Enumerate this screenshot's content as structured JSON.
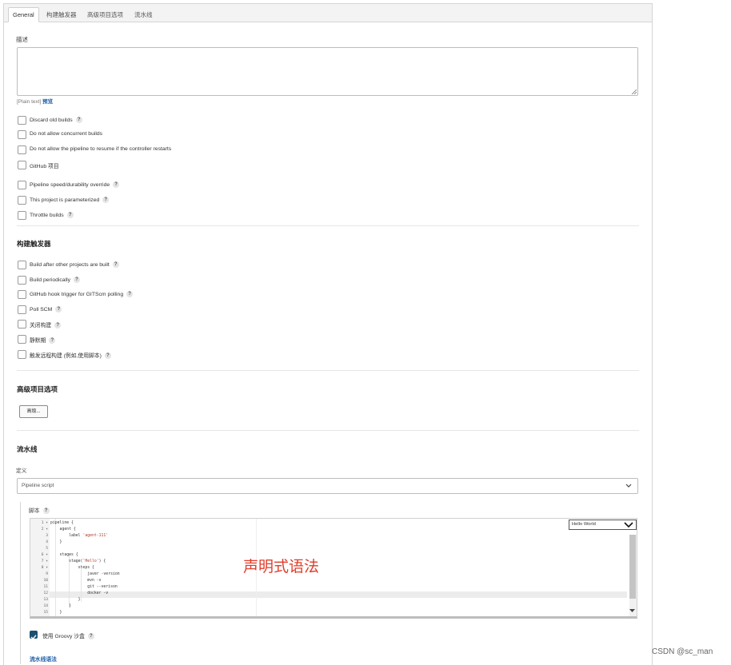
{
  "tabs": [
    {
      "label": "General"
    },
    {
      "label": "构建触发器"
    },
    {
      "label": "高级项目选项"
    },
    {
      "label": "流水线"
    }
  ],
  "general": {
    "description_label": "描述",
    "plain_text": "[Plain text]",
    "preview_link": "预览",
    "options": [
      {
        "label": "Discard old builds",
        "help": "?"
      },
      {
        "label": "Do not allow concurrent builds"
      },
      {
        "label": "Do not allow the pipeline to resume if the controller restarts"
      },
      {
        "label": "GitHub 项目"
      },
      {
        "label": "Pipeline speed/durability override",
        "help": "?"
      },
      {
        "label": "This project is parameterized",
        "help": "?"
      },
      {
        "label": "Throttle builds",
        "help": "?"
      }
    ]
  },
  "triggers": {
    "title": "构建触发器",
    "options": [
      {
        "label": "Build after other projects are built",
        "help": "?"
      },
      {
        "label": "Build periodically",
        "help": "?"
      },
      {
        "label": "GitHub hook trigger for GITScm polling",
        "help": "?"
      },
      {
        "label": "Poll SCM",
        "help": "?"
      },
      {
        "label": "关闭构建",
        "help": "?"
      },
      {
        "label": "静默期",
        "help": "?"
      },
      {
        "label": "触发远程构建 (例如,使用脚本)",
        "help": "?"
      }
    ]
  },
  "advanced": {
    "title": "高级项目选项",
    "button_label": "高级..."
  },
  "pipeline": {
    "title": "流水线",
    "definition_label": "定义",
    "definition_value": "Pipeline script",
    "script_label": "脚本",
    "script_help": "?",
    "sample_value": "Hello World",
    "code_lines": [
      {
        "no": "1 ▾",
        "text": "pipeline {"
      },
      {
        "no": "2 ▾",
        "text": "    agent {"
      },
      {
        "no": "3",
        "text": "        label ",
        "str": "'agent-111'"
      },
      {
        "no": "4",
        "text": "    }"
      },
      {
        "no": "5",
        "text": ""
      },
      {
        "no": "6 ▾",
        "text": "    stages {"
      },
      {
        "no": "7 ▾",
        "text": "        stage(",
        "str": "'Hello'",
        "tail": ") {"
      },
      {
        "no": "8 ▾",
        "text": "            steps {"
      },
      {
        "no": "9",
        "text": "                javer -version"
      },
      {
        "no": "10",
        "text": "                mvn -v"
      },
      {
        "no": "11",
        "text": "                git --verison"
      },
      {
        "no": "12",
        "text": "                docker -v"
      },
      {
        "no": "13",
        "text": "            }"
      },
      {
        "no": "14",
        "text": "        }"
      },
      {
        "no": "15",
        "text": "    }"
      }
    ],
    "groovy_sandbox_label": "使用 Groovy 沙盒",
    "groovy_help": "?",
    "syntax_link": "流水线语法"
  },
  "overlay_text": "声明式语法",
  "watermark": "CSDN @sc_man",
  "colors": {
    "link": "#1f5fa8",
    "annotation": "#e13d2b",
    "checkbox_checked": "#1c4e72"
  }
}
